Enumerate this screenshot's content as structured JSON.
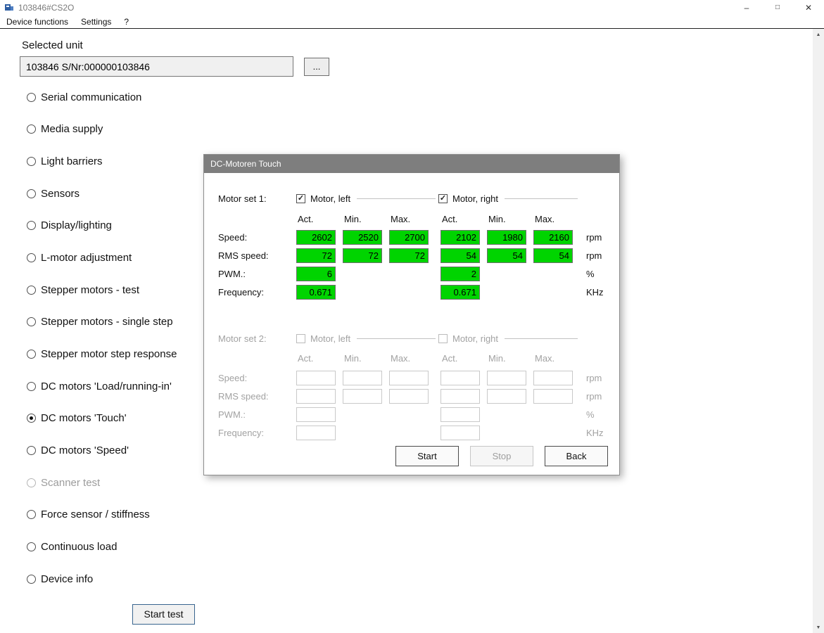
{
  "titlebar": {
    "title": "103846#CS2O",
    "controls": {
      "minimize": "–",
      "maximize": "□",
      "close": "✕"
    }
  },
  "menubar": {
    "items": [
      "Device functions",
      "Settings",
      "?"
    ]
  },
  "icons": {
    "check": "✓",
    "scroll_up": "▲",
    "scroll_down": "▼"
  },
  "colors": {
    "value_bg": "#00d400",
    "dialog_title_bg": "#7e7e7e",
    "app_icon": "#2f5fa3"
  },
  "main": {
    "selected_unit_label": "Selected unit",
    "unit_field_value": "103846 S/Nr:000000103846",
    "browse_button_label": "...",
    "test_options": [
      {
        "label": "Serial communication",
        "selected": false,
        "enabled": true
      },
      {
        "label": "Media supply",
        "selected": false,
        "enabled": true
      },
      {
        "label": "Light barriers",
        "selected": false,
        "enabled": true
      },
      {
        "label": "Sensors",
        "selected": false,
        "enabled": true
      },
      {
        "label": "Display/lighting",
        "selected": false,
        "enabled": true
      },
      {
        "label": "L-motor adjustment",
        "selected": false,
        "enabled": true
      },
      {
        "label": "Stepper motors - test",
        "selected": false,
        "enabled": true
      },
      {
        "label": "Stepper motors - single step",
        "selected": false,
        "enabled": true
      },
      {
        "label": "Stepper motor step response",
        "selected": false,
        "enabled": true
      },
      {
        "label": "DC motors 'Load/running-in'",
        "selected": false,
        "enabled": true
      },
      {
        "label": "DC motors 'Touch'",
        "selected": true,
        "enabled": true
      },
      {
        "label": "DC motors 'Speed'",
        "selected": false,
        "enabled": true
      },
      {
        "label": "Scanner test",
        "selected": false,
        "enabled": false
      },
      {
        "label": "Force sensor / stiffness",
        "selected": false,
        "enabled": true
      },
      {
        "label": "Continuous load",
        "selected": false,
        "enabled": true
      },
      {
        "label": "Device info",
        "selected": false,
        "enabled": true
      }
    ],
    "start_test_button": "Start test"
  },
  "dialog": {
    "title": "DC-Motoren Touch",
    "set1": {
      "label": "Motor set 1:",
      "motor_left": {
        "label": "Motor, left",
        "checked": true
      },
      "motor_right": {
        "label": "Motor, right",
        "checked": true
      },
      "columns": [
        "Act.",
        "Min.",
        "Max."
      ],
      "rows": [
        {
          "label": "Speed:",
          "left": [
            "2602",
            "2520",
            "2700"
          ],
          "right": [
            "2102",
            "1980",
            "2160"
          ],
          "unit": "rpm"
        },
        {
          "label": "RMS speed:",
          "left": [
            "72",
            "72",
            "72"
          ],
          "right": [
            "54",
            "54",
            "54"
          ],
          "unit": "rpm"
        },
        {
          "label": "PWM.:",
          "left": [
            "6"
          ],
          "right": [
            "2"
          ],
          "unit": "%"
        },
        {
          "label": "Frequency:",
          "left": [
            "0.671"
          ],
          "right": [
            "0.671"
          ],
          "unit": "KHz"
        }
      ]
    },
    "set2": {
      "label": "Motor set 2:",
      "motor_left": {
        "label": "Motor, left",
        "checked": false
      },
      "motor_right": {
        "label": "Motor, right",
        "checked": false
      },
      "columns": [
        "Act.",
        "Min.",
        "Max."
      ],
      "rows": [
        {
          "label": "Speed:",
          "left": [
            "",
            "",
            ""
          ],
          "right": [
            "",
            "",
            ""
          ],
          "unit": "rpm"
        },
        {
          "label": "RMS speed:",
          "left": [
            "",
            "",
            ""
          ],
          "right": [
            "",
            "",
            ""
          ],
          "unit": "rpm"
        },
        {
          "label": "PWM.:",
          "left": [
            ""
          ],
          "right": [
            ""
          ],
          "unit": "%"
        },
        {
          "label": "Frequency:",
          "left": [
            ""
          ],
          "right": [
            ""
          ],
          "unit": "KHz"
        }
      ]
    },
    "buttons": {
      "start": {
        "label": "Start",
        "enabled": true
      },
      "stop": {
        "label": "Stop",
        "enabled": false
      },
      "back": {
        "label": "Back",
        "enabled": true
      }
    }
  }
}
